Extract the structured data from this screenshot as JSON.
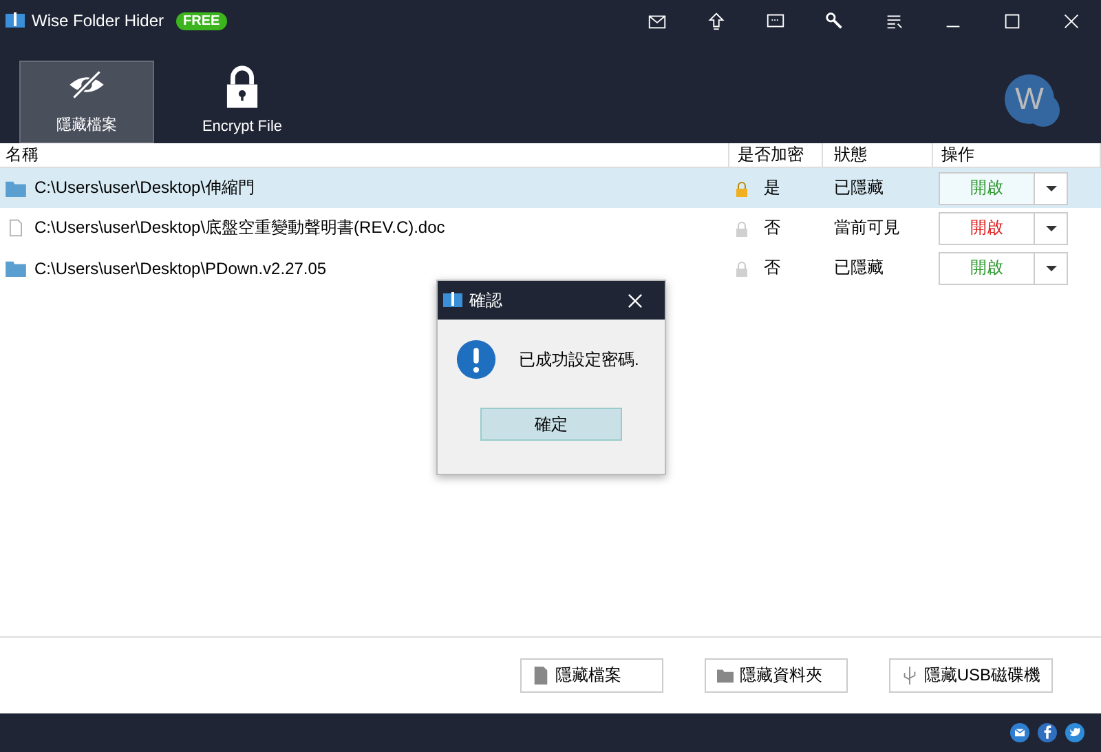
{
  "window": {
    "title": "Wise Folder Hider",
    "badge": "FREE"
  },
  "tools": [
    {
      "label": "隱藏檔案",
      "kind": "hide",
      "selected": true
    },
    {
      "label": "Encrypt File",
      "kind": "lock",
      "selected": false
    }
  ],
  "avatar": "W",
  "table": {
    "columns": [
      "名稱",
      "是否加密",
      "狀態",
      "操作"
    ],
    "rows": [
      {
        "kind": "folder",
        "path": "C:\\Users\\user\\Desktop\\伸縮門",
        "encrypted": true,
        "encrypted_text": "是",
        "status": "已隱藏",
        "action": {
          "label": "開啟",
          "color": "#2e9a2e"
        },
        "selected": true
      },
      {
        "kind": "file",
        "path": "C:\\Users\\user\\Desktop\\底盤空重變動聲明書(REV.C).doc",
        "encrypted": false,
        "encrypted_text": "否",
        "status": "當前可見",
        "action": {
          "label": "開啟",
          "color": "#e02020"
        },
        "selected": false
      },
      {
        "kind": "folder",
        "path": "C:\\Users\\user\\Desktop\\PDown.v2.27.05",
        "encrypted": false,
        "encrypted_text": "否",
        "status": "已隱藏",
        "action": {
          "label": "開啟",
          "color": "#2e9a2e"
        },
        "selected": false
      }
    ]
  },
  "dialog": {
    "title": "確認",
    "message": "已成功設定密碼.",
    "button": "確定"
  },
  "bottom_buttons": [
    {
      "label": "隱藏檔案",
      "kind": "file"
    },
    {
      "label": "隱藏資料夾",
      "kind": "folder"
    },
    {
      "label": "隱藏USB磁碟機",
      "kind": "usb"
    }
  ]
}
